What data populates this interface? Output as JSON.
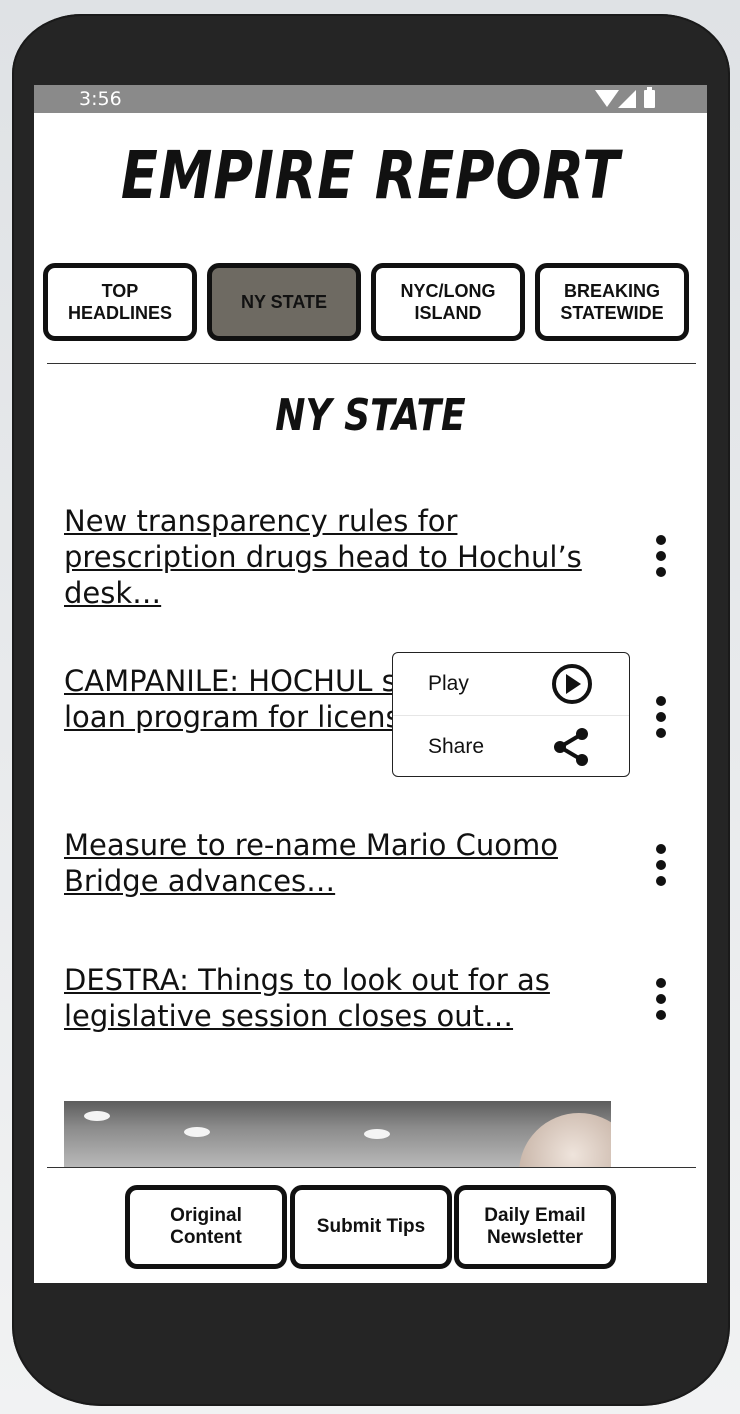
{
  "status_bar": {
    "time": "3:56",
    "icons": [
      "wifi-icon",
      "signal-icon",
      "battery-icon"
    ]
  },
  "app": {
    "title": "EMPIRE REPORT"
  },
  "tabs": [
    {
      "label": "TOP\nHEADLINES",
      "active": false
    },
    {
      "label": "NY STATE",
      "active": true
    },
    {
      "label": "NYC/LONG\nISLAND",
      "active": false
    },
    {
      "label": "BREAKING\nSTATEWIDE",
      "active": false
    }
  ],
  "section": {
    "title": "NY STATE"
  },
  "articles": [
    {
      "title": "New transparency rules for prescription drugs head to Hochul’s desk…"
    },
    {
      "title": "CAMPANILE: HOCHUL sets up $5M loan program for licensed pot stores…"
    },
    {
      "title": "Measure to re-name Mario Cuomo Bridge advances…"
    },
    {
      "title": "DESTRA: Things to look out for as legislative session closes out…"
    }
  ],
  "context_menu": {
    "items": [
      {
        "label": "Play",
        "icon": "play-icon"
      },
      {
        "label": "Share",
        "icon": "share-icon"
      }
    ]
  },
  "bottom_nav": [
    {
      "label": "Original\nContent"
    },
    {
      "label": "Submit Tips"
    },
    {
      "label": "Daily Email\nNewsletter"
    }
  ],
  "colors": {
    "active_tab": "#6e6a62",
    "status_bar": "#8a8a8a",
    "phone_frame": "#252525"
  }
}
